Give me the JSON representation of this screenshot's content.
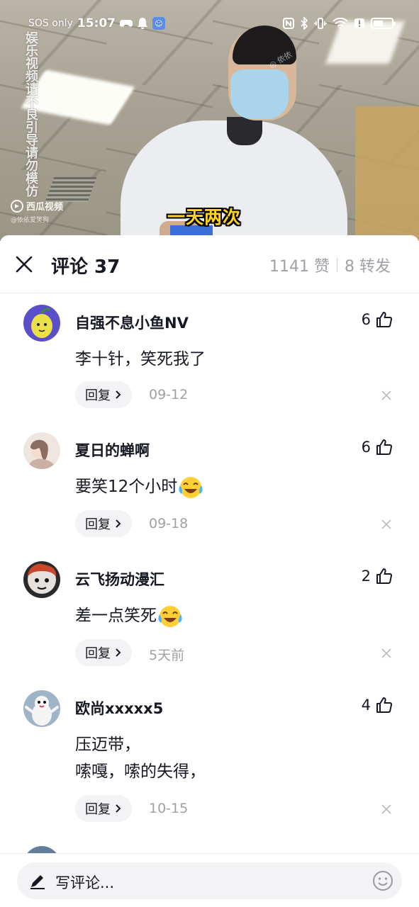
{
  "status_bar": {
    "carrier": "SOS only",
    "time": "15:07",
    "battery_level": 0.55
  },
  "video": {
    "watermark_vertical": "娱乐视频请不良引导请勿模仿",
    "platform_logo": "西瓜视频",
    "author_watermark": "@依依爱笑狗",
    "caption": "一天两次"
  },
  "comments_header": {
    "title": "评论 37",
    "likes": "1141 赞",
    "shares": "8 转发"
  },
  "comments": [
    {
      "username": "自强不息小鱼NV",
      "likes": "6",
      "text": "李十针，笑死我了",
      "text_line2": "",
      "emoji": "",
      "reply_label": "回复",
      "date": "09-12"
    },
    {
      "username": "夏日的蝉啊",
      "likes": "6",
      "text": "要笑12个小时",
      "text_line2": "",
      "emoji": "crying-laughing-emoji",
      "reply_label": "回复",
      "date": "09-18"
    },
    {
      "username": "云飞扬动漫汇",
      "likes": "2",
      "text": "差一点笑死",
      "text_line2": "",
      "emoji": "crying-laughing-emoji",
      "reply_label": "回复",
      "date": "5天前"
    },
    {
      "username": "欧尚xxxxx5",
      "likes": "4",
      "text": "压迈带，",
      "text_line2": "嗦嘎，嗦的失得，",
      "emoji": "",
      "reply_label": "回复",
      "date": "10-15"
    }
  ],
  "input": {
    "placeholder": "写评论..."
  },
  "icons": {
    "close": "close-icon",
    "like": "thumbs-up-icon",
    "dismiss": "x-icon",
    "pen": "pen-icon",
    "emoji": "smiley-icon"
  }
}
